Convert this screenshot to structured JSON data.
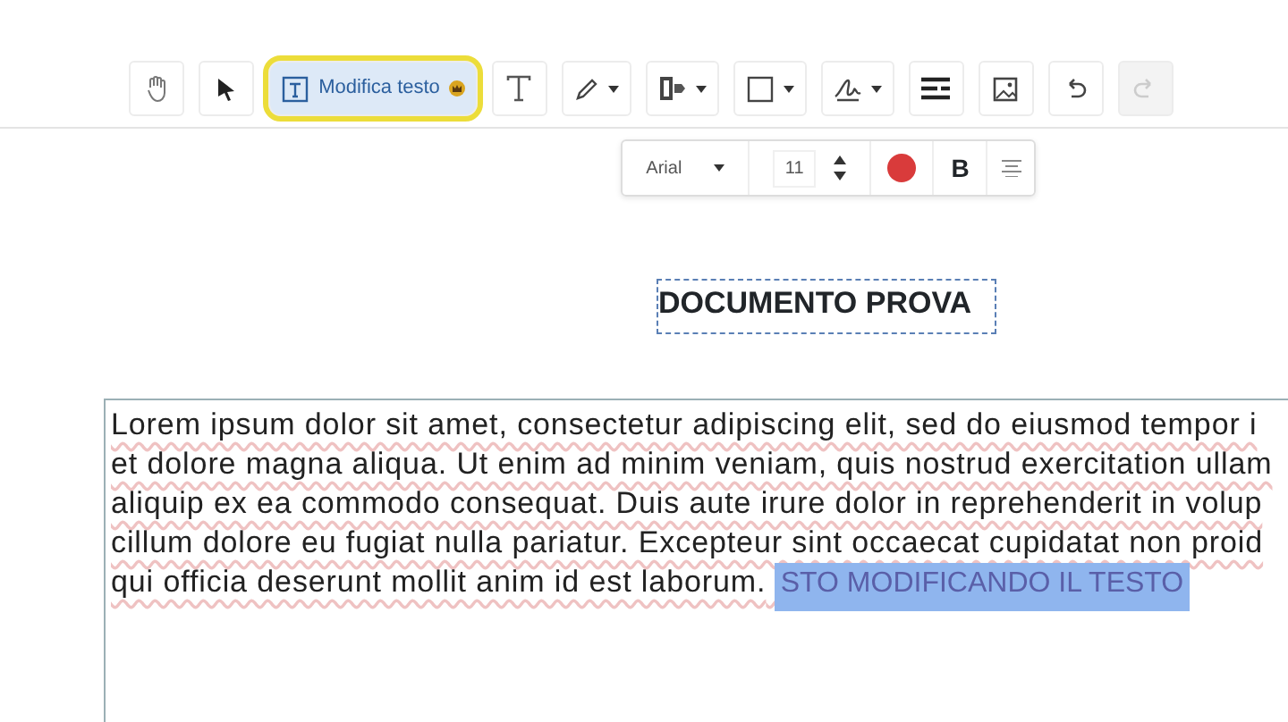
{
  "toolbar": [
    {
      "kind": "hand",
      "selected": false,
      "disabled": false,
      "dropdown": false
    },
    {
      "kind": "pointer",
      "selected": false,
      "disabled": false,
      "dropdown": false
    },
    {
      "kind": "edit-text",
      "label": "Modifica testo",
      "selected": true,
      "disabled": false,
      "dropdown": false,
      "premium": true
    },
    {
      "kind": "text",
      "selected": false,
      "disabled": false,
      "dropdown": false
    },
    {
      "kind": "pen",
      "selected": false,
      "disabled": false,
      "dropdown": true
    },
    {
      "kind": "stamp",
      "selected": false,
      "disabled": false,
      "dropdown": true
    },
    {
      "kind": "shape",
      "selected": false,
      "disabled": false,
      "dropdown": true
    },
    {
      "kind": "signature",
      "selected": false,
      "disabled": false,
      "dropdown": true
    },
    {
      "kind": "lines",
      "selected": false,
      "disabled": false,
      "dropdown": false
    },
    {
      "kind": "image",
      "selected": false,
      "disabled": false,
      "dropdown": false
    },
    {
      "kind": "undo",
      "selected": false,
      "disabled": false,
      "dropdown": false
    },
    {
      "kind": "redo",
      "selected": false,
      "disabled": true,
      "dropdown": false
    }
  ],
  "format_bar": {
    "font": "Arial",
    "size": "11",
    "color": "#d93b3b",
    "bold": true,
    "bold_label": "B"
  },
  "document": {
    "title": "DOCUMENTO PROVA",
    "lines": [
      {
        "text": "Lorem ipsum dolor sit amet, consectetur adipiscing elit, sed do eiusmod tempor i"
      },
      {
        "text": "et dolore magna aliqua. Ut enim ad minim veniam, quis nostrud exercitation ullam"
      },
      {
        "text": "aliquip ex ea commodo consequat. Duis aute irure dolor in reprehenderit in volup"
      },
      {
        "text": "cillum dolore eu fugiat nulla pariatur. Excepteur sint occaecat cupidatat non proid"
      },
      {
        "text": "qui officia deserunt mollit anim id est laborum.",
        "selection": "STO MODIFICANDO IL TESTO"
      }
    ]
  }
}
